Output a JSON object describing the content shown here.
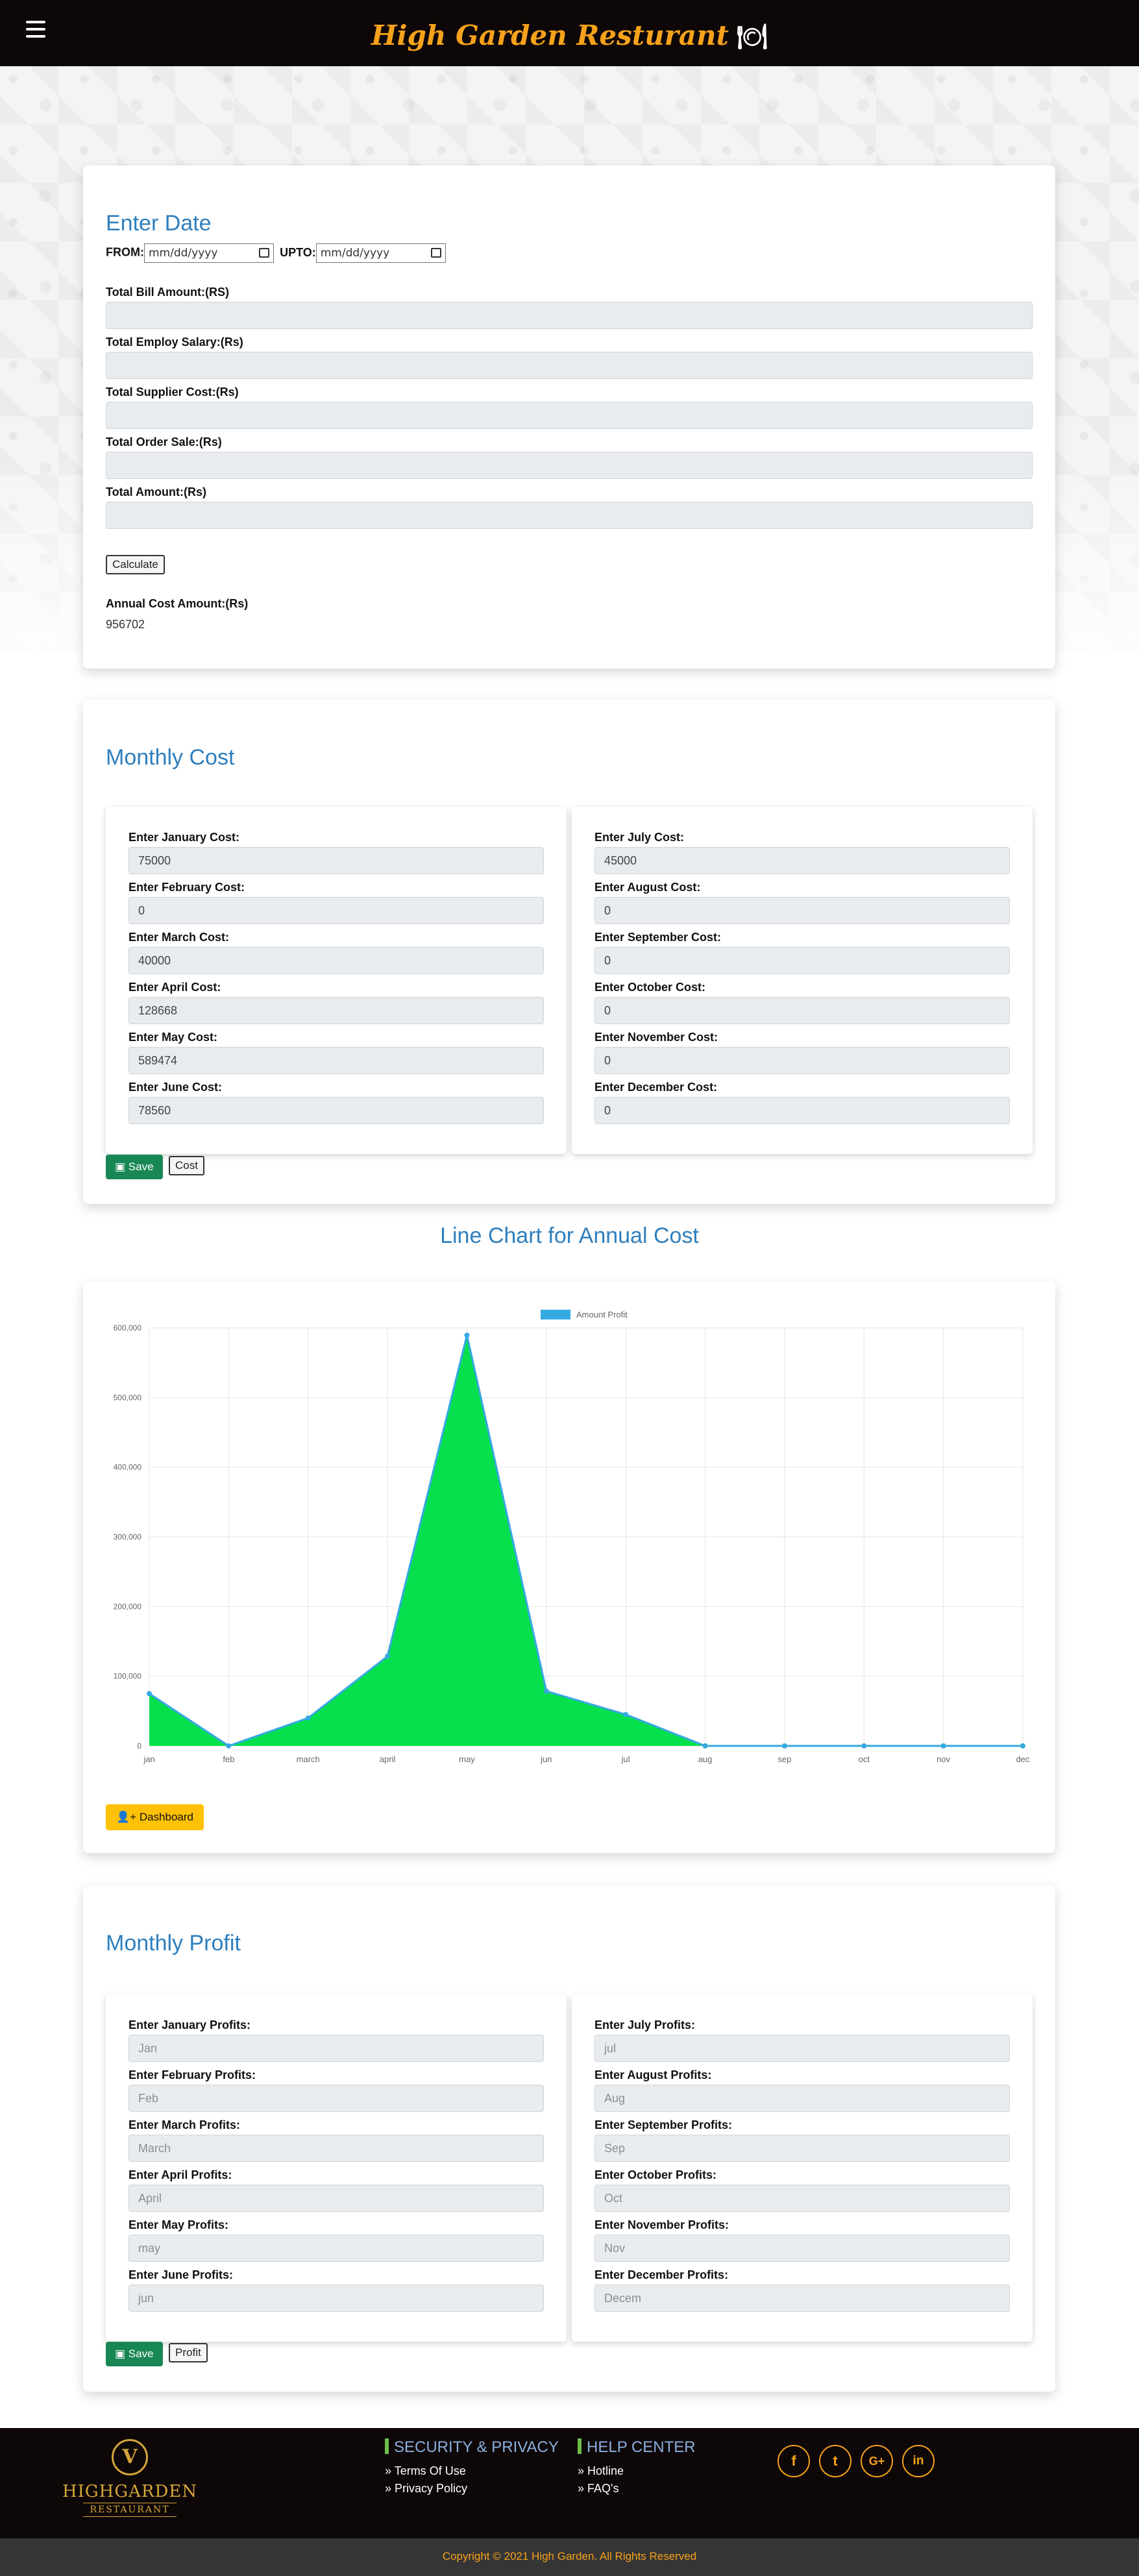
{
  "header": {
    "brand": "High Garden Resturant",
    "plate_icon": "plate-cutlery-icon"
  },
  "date_card": {
    "title": "Enter Date",
    "from_label": "FROM:",
    "from_placeholder": "mm/dd/yyyy",
    "upto_label": "UPTO:",
    "upto_placeholder": "mm/dd/yyyy",
    "fields": [
      {
        "label": "Total Bill Amount:(RS)",
        "value": ""
      },
      {
        "label": "Total Employ Salary:(Rs)",
        "value": ""
      },
      {
        "label": "Total Supplier Cost:(Rs)",
        "value": ""
      },
      {
        "label": "Total Order Sale:(Rs)",
        "value": ""
      },
      {
        "label": "Total Amount:(Rs)",
        "value": ""
      }
    ],
    "calculate_label": "Calculate",
    "annual_label": "Annual Cost Amount:(Rs)",
    "annual_value": "956702"
  },
  "cost_card": {
    "title": "Monthly Cost",
    "left": [
      {
        "label": "Enter January Cost:",
        "value": "75000"
      },
      {
        "label": "Enter February Cost:",
        "value": "0"
      },
      {
        "label": "Enter March Cost:",
        "value": "40000"
      },
      {
        "label": "Enter April Cost:",
        "value": "128668"
      },
      {
        "label": "Enter May Cost:",
        "value": "589474"
      },
      {
        "label": "Enter June Cost:",
        "value": "78560"
      }
    ],
    "right": [
      {
        "label": "Enter July Cost:",
        "value": "45000"
      },
      {
        "label": "Enter August Cost:",
        "value": "0"
      },
      {
        "label": "Enter September Cost:",
        "value": "0"
      },
      {
        "label": "Enter October Cost:",
        "value": "0"
      },
      {
        "label": "Enter November Cost:",
        "value": "0"
      },
      {
        "label": "Enter December Cost:",
        "value": "0"
      }
    ],
    "save_label": "Save",
    "cost_label": "Cost"
  },
  "chart_section": {
    "heading": "Line Chart for Annual Cost",
    "dashboard_label": "Dashboard"
  },
  "chart_data": {
    "type": "area",
    "title": "",
    "xlabel": "",
    "ylabel": "",
    "categories": [
      "jan",
      "feb",
      "march",
      "april",
      "may",
      "jun",
      "jul",
      "aug",
      "sep",
      "oct",
      "nov",
      "dec"
    ],
    "series": [
      {
        "name": "Amount Profit",
        "values": [
          75000,
          0,
          40000,
          128668,
          589474,
          78560,
          45000,
          0,
          0,
          0,
          0,
          0
        ]
      }
    ],
    "ylim": [
      0,
      600000
    ],
    "yticks": [
      "0",
      "100,000",
      "200,000",
      "300,000",
      "400,000",
      "500,000",
      "600,000"
    ],
    "grid": true,
    "legend_position": "top",
    "colors": {
      "fill": "#05e04c",
      "line": "#36a9e1"
    }
  },
  "profit_card": {
    "title": "Monthly Profit",
    "left": [
      {
        "label": "Enter January Profits:",
        "placeholder": "Jan"
      },
      {
        "label": "Enter February Profits:",
        "placeholder": "Feb"
      },
      {
        "label": "Enter March Profits:",
        "placeholder": "March"
      },
      {
        "label": "Enter April Profits:",
        "placeholder": "April"
      },
      {
        "label": "Enter May Profits:",
        "placeholder": "may"
      },
      {
        "label": "Enter June Profits:",
        "placeholder": "jun"
      }
    ],
    "right": [
      {
        "label": "Enter July Profits:",
        "placeholder": "jul"
      },
      {
        "label": "Enter August Profits:",
        "placeholder": "Aug"
      },
      {
        "label": "Enter September Profits:",
        "placeholder": "Sep"
      },
      {
        "label": "Enter October Profits:",
        "placeholder": "Oct"
      },
      {
        "label": "Enter November Profits:",
        "placeholder": "Nov"
      },
      {
        "label": "Enter December Profits:",
        "placeholder": "Decem"
      }
    ],
    "save_label": "Save",
    "profit_label": "Profit"
  },
  "footer": {
    "logo_letter": "V",
    "logo_name": "HIGHGARDEN",
    "logo_sub": "RESTAURANT",
    "security_heading": "SECURITY & PRIVACY",
    "security_links": [
      "Terms Of Use",
      "Privacy Policy"
    ],
    "help_heading": "HELP CENTER",
    "help_links": [
      "Hotline",
      "FAQ's"
    ],
    "social": [
      "f",
      "t",
      "G+",
      "in"
    ],
    "copyright": "Copyright © 2021 High Garden. All Rights Reserved"
  }
}
